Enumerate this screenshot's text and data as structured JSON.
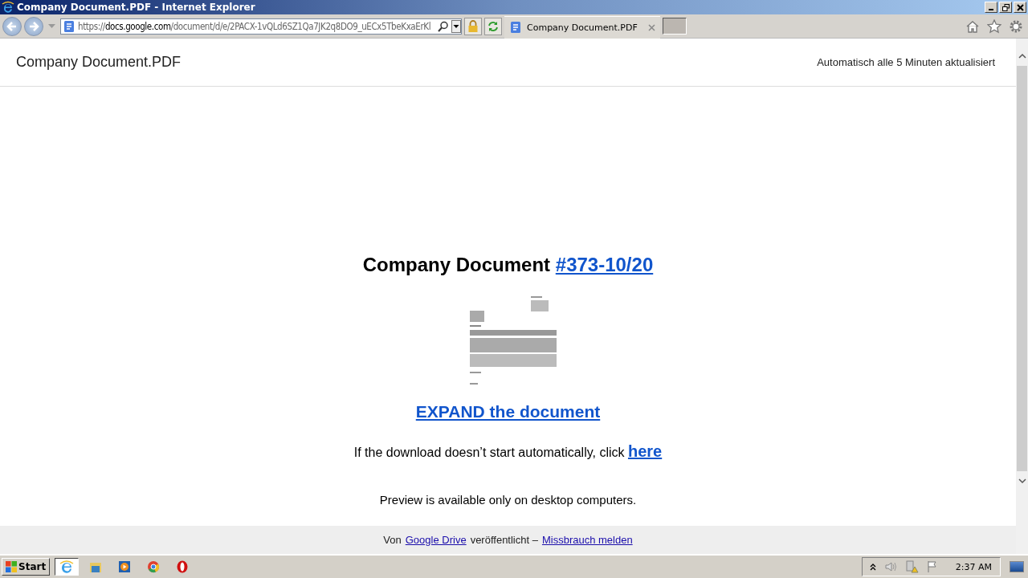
{
  "window": {
    "title": "Company Document.PDF - Internet Explorer"
  },
  "address_bar": {
    "scheme": "https://",
    "domain": "docs.google.com",
    "path": "/document/d/e/2PACX-1vQLd6SZ1Qa7JK2q8DO9_uECx5TbeKxaErKl"
  },
  "tabs": [
    {
      "label": "Company Document.PDF",
      "selected": true
    }
  ],
  "page_header": {
    "title": "Company Document.PDF",
    "note": "Automatisch alle 5 Minuten aktualisiert"
  },
  "heading": {
    "text": "Company Document",
    "link": "#373-10/20"
  },
  "expand_link": "EXPAND the document",
  "download": {
    "text": "If the download doesn’t start automatically, click",
    "link": "here"
  },
  "preview_note": "Preview is available only on desktop computers.",
  "footer": {
    "prefix": "Von",
    "source_link": "Google Drive",
    "middle": "veröffentlicht  –",
    "report_link": "Missbrauch melden"
  },
  "taskbar": {
    "start": "Start",
    "apps": [
      {
        "kind": "ie",
        "selected": true
      },
      {
        "kind": "folder",
        "selected": false
      },
      {
        "kind": "media",
        "selected": false
      },
      {
        "kind": "chrome",
        "selected": false
      },
      {
        "kind": "opera",
        "selected": false
      }
    ],
    "clock": "2:37 AM"
  }
}
